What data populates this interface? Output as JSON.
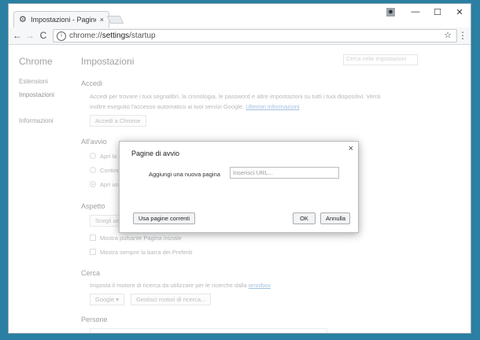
{
  "tab": {
    "title": "Impostazioni - Pagine di",
    "close": "×"
  },
  "window_controls": {
    "profile": "●",
    "minimize": "—",
    "maximize": "☐",
    "close": "✕"
  },
  "toolbar": {
    "back": "←",
    "forward": "→",
    "reload": "C",
    "url_scheme": "chrome://",
    "url_host": "settings",
    "url_path": "/startup",
    "star": "☆",
    "menu": "⋮"
  },
  "sidebar": {
    "brand": "Chrome",
    "items": [
      "Estensioni",
      "Impostazioni",
      "Informazioni"
    ]
  },
  "main": {
    "title": "Impostazioni",
    "search_placeholder": "Cerca nelle impostazioni",
    "accedi": {
      "heading": "Accedi",
      "line1": "Accedi per trovare i tuoi segnalibri, la cronologia, le password e altre impostazioni su tutti i tuoi dispositivi. Verrà",
      "line2": "inoltre eseguito l'accesso automatico ai tuoi servizi Google.",
      "link": "Ulteriori informazioni",
      "button": "Accedi a Chrome"
    },
    "avvio": {
      "heading": "All'avvio",
      "options": [
        "Apri la pa",
        "Continua",
        "Apri una"
      ]
    },
    "aspetto": {
      "heading": "Aspetto",
      "button": "Scegli un te",
      "check1": "Mostra pulsante Pagina iniziale",
      "check2": "Mostra sempre la barra dei Preferiti"
    },
    "cerca": {
      "heading": "Cerca",
      "text": "Imposta il motore di ricerca da utilizzare per le ricerche dalla",
      "link": "omnibox",
      "engine": "Google",
      "manage": "Gestisci motori di ricerca..."
    },
    "persone": {
      "heading": "Persone"
    }
  },
  "dialog": {
    "title": "Pagine di avvio",
    "close": "×",
    "label": "Aggiungi una nuova pagina",
    "input_placeholder": "Inserisci URL...",
    "use_current": "Usa pagine correnti",
    "ok": "OK",
    "cancel": "Annulla"
  }
}
